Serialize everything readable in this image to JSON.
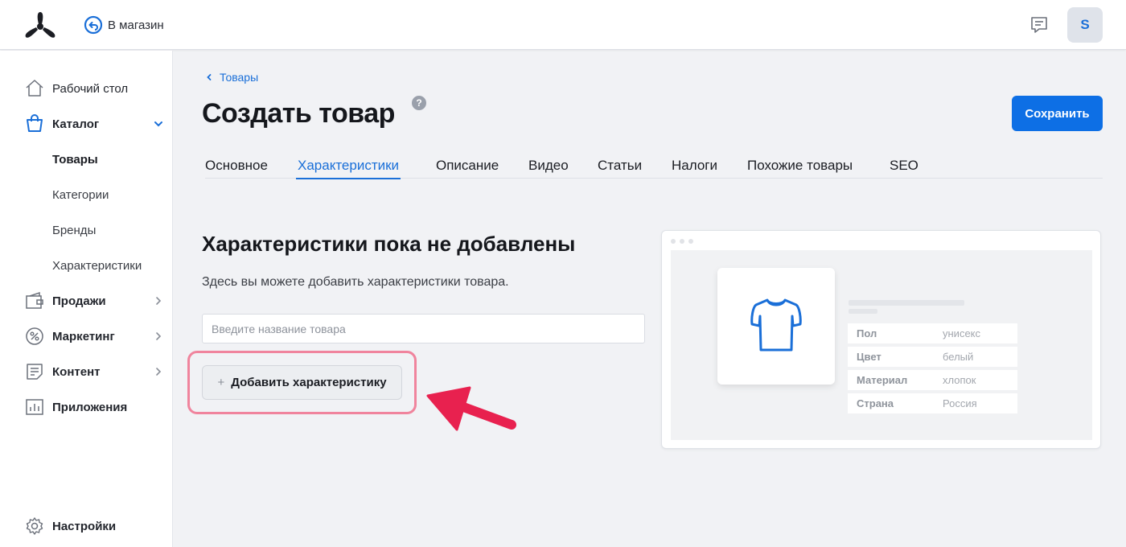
{
  "header": {
    "back_to_store": "В магазин",
    "avatar_letter": "S"
  },
  "sidebar": {
    "items": [
      {
        "label": "Рабочий стол",
        "icon": "home-icon"
      },
      {
        "label": "Каталог",
        "icon": "shopping-bag-icon",
        "expanded": true
      },
      {
        "label": "Товары",
        "sub": true,
        "active": true
      },
      {
        "label": "Категории",
        "sub": true
      },
      {
        "label": "Бренды",
        "sub": true
      },
      {
        "label": "Характеристики",
        "sub": true
      },
      {
        "label": "Продажи",
        "icon": "wallet-icon"
      },
      {
        "label": "Маркетинг",
        "icon": "percent-icon"
      },
      {
        "label": "Контент",
        "icon": "document-icon"
      },
      {
        "label": "Приложения",
        "icon": "chart-icon"
      }
    ],
    "settings": "Настройки"
  },
  "main": {
    "breadcrumb": "Товары",
    "title": "Создать товар",
    "help": "?",
    "save": "Сохранить",
    "tabs": [
      "Основное",
      "Характеристики",
      "Описание",
      "Видео",
      "Статьи",
      "Налоги",
      "Похожие товары",
      "SEO"
    ],
    "active_tab": "Характеристики",
    "empty_title": "Характеристики пока не добавлены",
    "empty_desc": "Здесь вы можете добавить характеристики товара.",
    "input_placeholder": "Введите название товара",
    "add_button": "Добавить характеристику",
    "add_plus": "+"
  },
  "preview": {
    "specs": [
      {
        "key": "Пол",
        "value": "унисекс"
      },
      {
        "key": "Цвет",
        "value": "белый"
      },
      {
        "key": "Материал",
        "value": "хлопок"
      },
      {
        "key": "Страна",
        "value": "Россия"
      }
    ]
  },
  "colors": {
    "accent": "#1a6fd8",
    "save_button": "#0d6fe5",
    "highlight": "#f0849d",
    "arrow": "#e8214f"
  }
}
